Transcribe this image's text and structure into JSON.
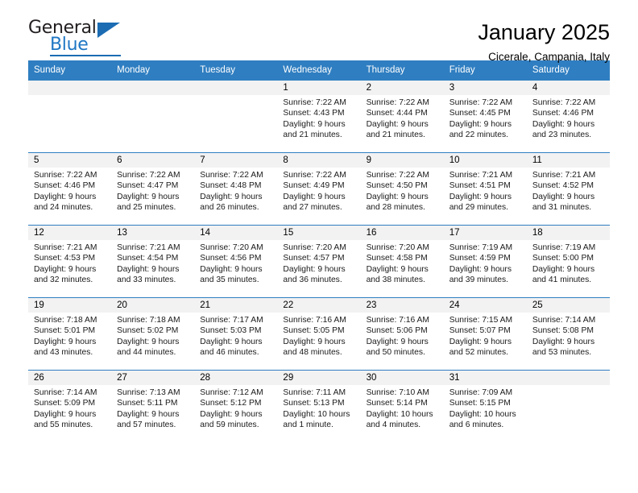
{
  "brand": {
    "name_top": "General",
    "name_bottom": "Blue",
    "accent_color": "#1b6cb3",
    "triangle_icon": "triangle-icon"
  },
  "header": {
    "title": "January 2025",
    "location": "Cicerale, Campania, Italy"
  },
  "calendar": {
    "header_bg": "#2f7ec1",
    "daynum_bg": "#f2f2f2",
    "weekdays": [
      "Sunday",
      "Monday",
      "Tuesday",
      "Wednesday",
      "Thursday",
      "Friday",
      "Saturday"
    ],
    "weeks": [
      [
        {
          "day": "",
          "lines": []
        },
        {
          "day": "",
          "lines": []
        },
        {
          "day": "",
          "lines": []
        },
        {
          "day": "1",
          "lines": [
            "Sunrise: 7:22 AM",
            "Sunset: 4:43 PM",
            "Daylight: 9 hours",
            "and 21 minutes."
          ]
        },
        {
          "day": "2",
          "lines": [
            "Sunrise: 7:22 AM",
            "Sunset: 4:44 PM",
            "Daylight: 9 hours",
            "and 21 minutes."
          ]
        },
        {
          "day": "3",
          "lines": [
            "Sunrise: 7:22 AM",
            "Sunset: 4:45 PM",
            "Daylight: 9 hours",
            "and 22 minutes."
          ]
        },
        {
          "day": "4",
          "lines": [
            "Sunrise: 7:22 AM",
            "Sunset: 4:46 PM",
            "Daylight: 9 hours",
            "and 23 minutes."
          ]
        }
      ],
      [
        {
          "day": "5",
          "lines": [
            "Sunrise: 7:22 AM",
            "Sunset: 4:46 PM",
            "Daylight: 9 hours",
            "and 24 minutes."
          ]
        },
        {
          "day": "6",
          "lines": [
            "Sunrise: 7:22 AM",
            "Sunset: 4:47 PM",
            "Daylight: 9 hours",
            "and 25 minutes."
          ]
        },
        {
          "day": "7",
          "lines": [
            "Sunrise: 7:22 AM",
            "Sunset: 4:48 PM",
            "Daylight: 9 hours",
            "and 26 minutes."
          ]
        },
        {
          "day": "8",
          "lines": [
            "Sunrise: 7:22 AM",
            "Sunset: 4:49 PM",
            "Daylight: 9 hours",
            "and 27 minutes."
          ]
        },
        {
          "day": "9",
          "lines": [
            "Sunrise: 7:22 AM",
            "Sunset: 4:50 PM",
            "Daylight: 9 hours",
            "and 28 minutes."
          ]
        },
        {
          "day": "10",
          "lines": [
            "Sunrise: 7:21 AM",
            "Sunset: 4:51 PM",
            "Daylight: 9 hours",
            "and 29 minutes."
          ]
        },
        {
          "day": "11",
          "lines": [
            "Sunrise: 7:21 AM",
            "Sunset: 4:52 PM",
            "Daylight: 9 hours",
            "and 31 minutes."
          ]
        }
      ],
      [
        {
          "day": "12",
          "lines": [
            "Sunrise: 7:21 AM",
            "Sunset: 4:53 PM",
            "Daylight: 9 hours",
            "and 32 minutes."
          ]
        },
        {
          "day": "13",
          "lines": [
            "Sunrise: 7:21 AM",
            "Sunset: 4:54 PM",
            "Daylight: 9 hours",
            "and 33 minutes."
          ]
        },
        {
          "day": "14",
          "lines": [
            "Sunrise: 7:20 AM",
            "Sunset: 4:56 PM",
            "Daylight: 9 hours",
            "and 35 minutes."
          ]
        },
        {
          "day": "15",
          "lines": [
            "Sunrise: 7:20 AM",
            "Sunset: 4:57 PM",
            "Daylight: 9 hours",
            "and 36 minutes."
          ]
        },
        {
          "day": "16",
          "lines": [
            "Sunrise: 7:20 AM",
            "Sunset: 4:58 PM",
            "Daylight: 9 hours",
            "and 38 minutes."
          ]
        },
        {
          "day": "17",
          "lines": [
            "Sunrise: 7:19 AM",
            "Sunset: 4:59 PM",
            "Daylight: 9 hours",
            "and 39 minutes."
          ]
        },
        {
          "day": "18",
          "lines": [
            "Sunrise: 7:19 AM",
            "Sunset: 5:00 PM",
            "Daylight: 9 hours",
            "and 41 minutes."
          ]
        }
      ],
      [
        {
          "day": "19",
          "lines": [
            "Sunrise: 7:18 AM",
            "Sunset: 5:01 PM",
            "Daylight: 9 hours",
            "and 43 minutes."
          ]
        },
        {
          "day": "20",
          "lines": [
            "Sunrise: 7:18 AM",
            "Sunset: 5:02 PM",
            "Daylight: 9 hours",
            "and 44 minutes."
          ]
        },
        {
          "day": "21",
          "lines": [
            "Sunrise: 7:17 AM",
            "Sunset: 5:03 PM",
            "Daylight: 9 hours",
            "and 46 minutes."
          ]
        },
        {
          "day": "22",
          "lines": [
            "Sunrise: 7:16 AM",
            "Sunset: 5:05 PM",
            "Daylight: 9 hours",
            "and 48 minutes."
          ]
        },
        {
          "day": "23",
          "lines": [
            "Sunrise: 7:16 AM",
            "Sunset: 5:06 PM",
            "Daylight: 9 hours",
            "and 50 minutes."
          ]
        },
        {
          "day": "24",
          "lines": [
            "Sunrise: 7:15 AM",
            "Sunset: 5:07 PM",
            "Daylight: 9 hours",
            "and 52 minutes."
          ]
        },
        {
          "day": "25",
          "lines": [
            "Sunrise: 7:14 AM",
            "Sunset: 5:08 PM",
            "Daylight: 9 hours",
            "and 53 minutes."
          ]
        }
      ],
      [
        {
          "day": "26",
          "lines": [
            "Sunrise: 7:14 AM",
            "Sunset: 5:09 PM",
            "Daylight: 9 hours",
            "and 55 minutes."
          ]
        },
        {
          "day": "27",
          "lines": [
            "Sunrise: 7:13 AM",
            "Sunset: 5:11 PM",
            "Daylight: 9 hours",
            "and 57 minutes."
          ]
        },
        {
          "day": "28",
          "lines": [
            "Sunrise: 7:12 AM",
            "Sunset: 5:12 PM",
            "Daylight: 9 hours",
            "and 59 minutes."
          ]
        },
        {
          "day": "29",
          "lines": [
            "Sunrise: 7:11 AM",
            "Sunset: 5:13 PM",
            "Daylight: 10 hours",
            "and 1 minute."
          ]
        },
        {
          "day": "30",
          "lines": [
            "Sunrise: 7:10 AM",
            "Sunset: 5:14 PM",
            "Daylight: 10 hours",
            "and 4 minutes."
          ]
        },
        {
          "day": "31",
          "lines": [
            "Sunrise: 7:09 AM",
            "Sunset: 5:15 PM",
            "Daylight: 10 hours",
            "and 6 minutes."
          ]
        },
        {
          "day": "",
          "lines": []
        }
      ]
    ]
  }
}
